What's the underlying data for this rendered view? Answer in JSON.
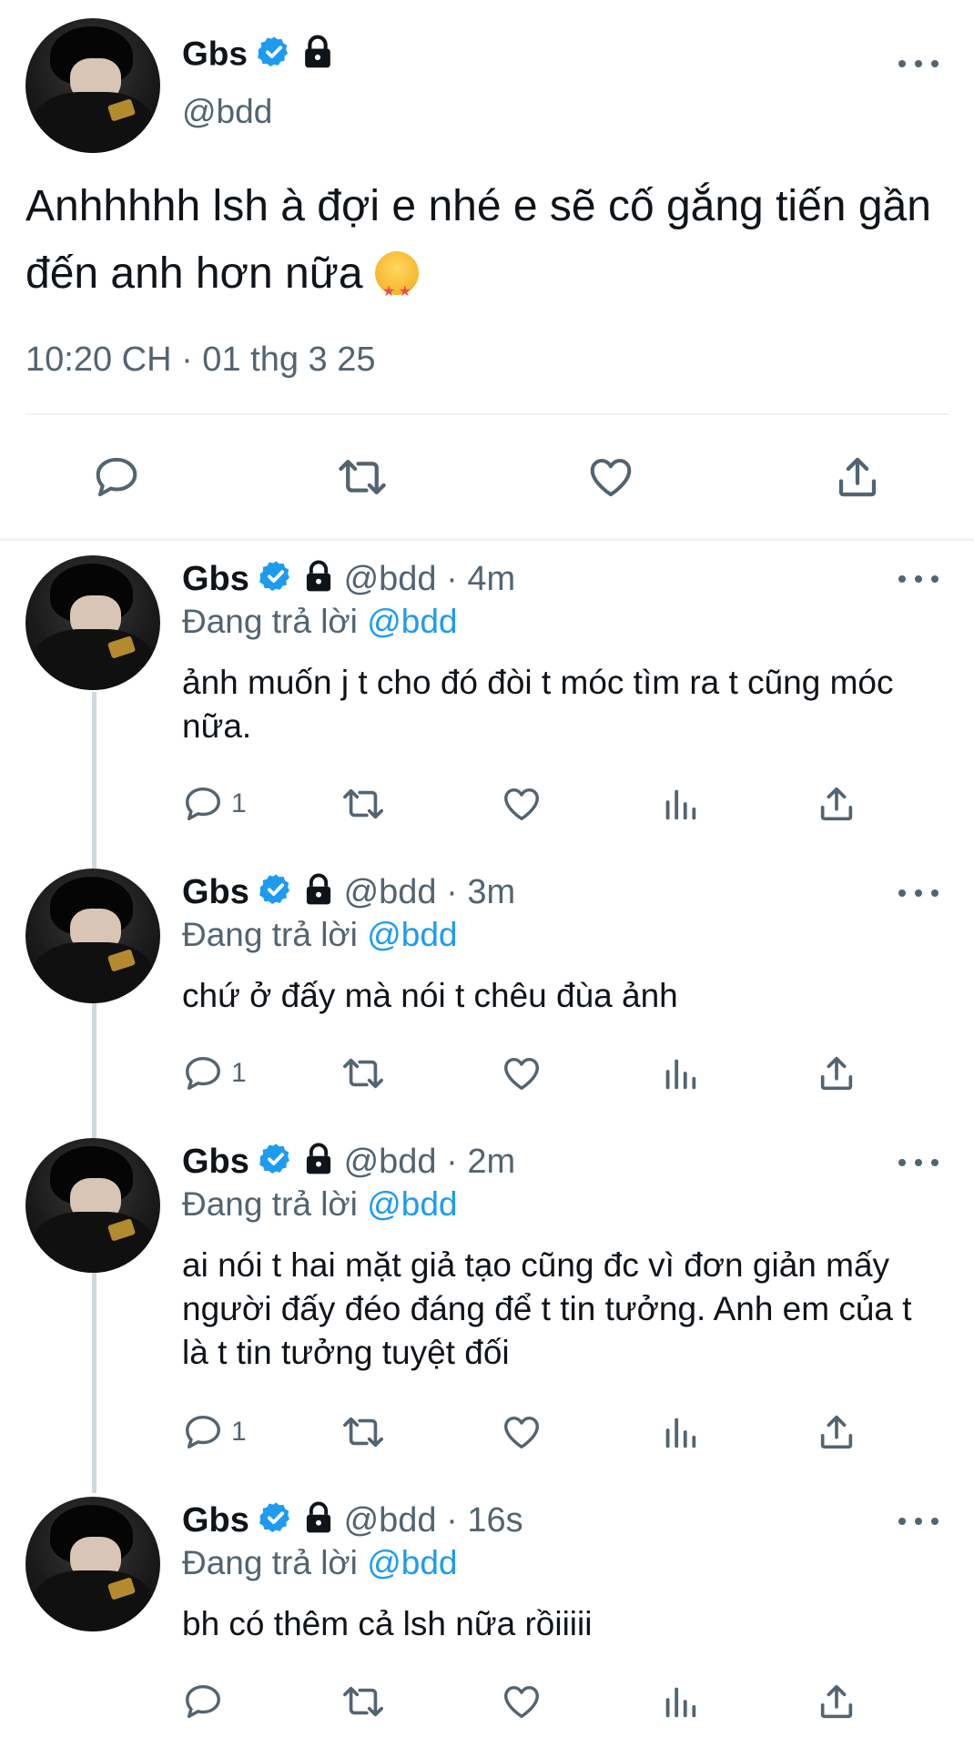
{
  "main_tweet": {
    "name": "Gbs",
    "handle": "@bdd",
    "text": "Anhhhhh lsh à đợi e nhé e sẽ cố gắng tiến gần đến anh hơn nữa",
    "emoji": "star-struck-emoji",
    "timestamp": "10:20 CH · 01 thg 3 25",
    "actions": [
      "reply-icon",
      "retweet-icon",
      "like-icon",
      "share-icon"
    ]
  },
  "replies": [
    {
      "name": "Gbs",
      "handle": "@bdd",
      "time": "4m",
      "replying_prefix": "Đang trả lời",
      "replying_to": "@bdd",
      "text": "ảnh muốn j t cho đó đòi t móc tìm ra t cũng móc nữa.",
      "reply_count": "1"
    },
    {
      "name": "Gbs",
      "handle": "@bdd",
      "time": "3m",
      "replying_prefix": "Đang trả lời",
      "replying_to": "@bdd",
      "text": "chứ ở đấy mà nói t chêu đùa ảnh",
      "reply_count": "1"
    },
    {
      "name": "Gbs",
      "handle": "@bdd",
      "time": "2m",
      "replying_prefix": "Đang trả lời",
      "replying_to": "@bdd",
      "text": "ai nói t hai mặt giả tạo cũng đc vì đơn giản mấy người đấy đéo đáng để t tin tưởng. Anh em của  t là t tin tưởng tuyệt đối",
      "reply_count": "1"
    },
    {
      "name": "Gbs",
      "handle": "@bdd",
      "time": "16s",
      "replying_prefix": "Đang trả lời",
      "replying_to": "@bdd",
      "text": "bh có thêm cả lsh nữa rồiiiii",
      "reply_count": ""
    }
  ],
  "colors": {
    "verified": "#1d9bf0",
    "text": "#0f1419",
    "muted": "#536471",
    "link": "#1d9bf0"
  }
}
